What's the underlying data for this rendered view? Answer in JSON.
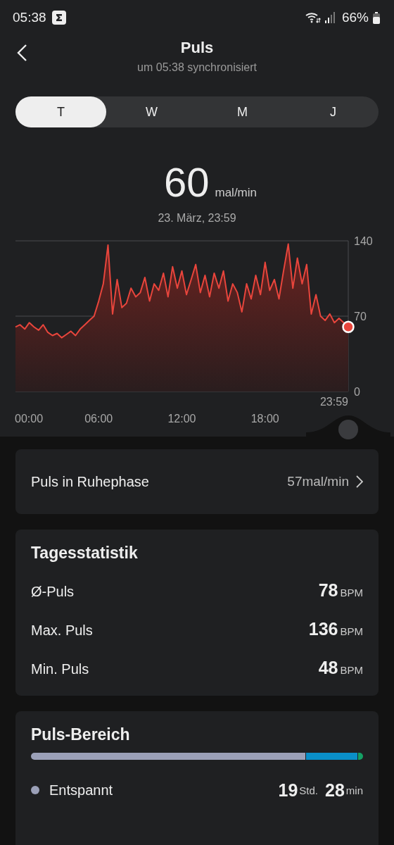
{
  "status_bar": {
    "time": "05:38",
    "battery": "66%"
  },
  "header": {
    "title": "Puls",
    "subtitle": "um 05:38 synchronisiert"
  },
  "tabs": [
    {
      "label": "T",
      "selected": true
    },
    {
      "label": "W",
      "selected": false
    },
    {
      "label": "M",
      "selected": false
    },
    {
      "label": "J",
      "selected": false
    }
  ],
  "reading": {
    "value": "60",
    "unit": "mal/min",
    "date": "23. März, 23:59"
  },
  "chart_data": {
    "type": "area",
    "xlim": [
      0,
      24
    ],
    "ylim": [
      0,
      140
    ],
    "yticks": [
      0,
      70,
      140
    ],
    "xticks": [
      {
        "value": 0,
        "label": "00:00"
      },
      {
        "value": 6,
        "label": "06:00"
      },
      {
        "value": 12,
        "label": "12:00"
      },
      {
        "value": 18,
        "label": "18:00"
      }
    ],
    "x": [
      0,
      0.33,
      0.67,
      1,
      1.33,
      1.67,
      2,
      2.33,
      2.67,
      3,
      3.33,
      3.67,
      4,
      4.33,
      4.67,
      5,
      5.33,
      5.67,
      6,
      6.33,
      6.67,
      7,
      7.33,
      7.67,
      8,
      8.33,
      8.67,
      9,
      9.33,
      9.67,
      10,
      10.33,
      10.67,
      11,
      11.33,
      11.67,
      12,
      12.33,
      12.67,
      13,
      13.33,
      13.67,
      14,
      14.33,
      14.67,
      15,
      15.33,
      15.67,
      16,
      16.33,
      16.67,
      17,
      17.33,
      17.67,
      18,
      18.33,
      18.67,
      19,
      19.33,
      19.67,
      20,
      20.33,
      20.67,
      21,
      21.33,
      21.67,
      22,
      22.33,
      22.67,
      23,
      23.33,
      24
    ],
    "series": [
      {
        "color": "#e8453c",
        "values": [
          60,
          62,
          58,
          64,
          60,
          57,
          62,
          55,
          52,
          54,
          50,
          53,
          56,
          52,
          58,
          62,
          66,
          70,
          84,
          100,
          136,
          72,
          104,
          78,
          82,
          96,
          88,
          92,
          106,
          84,
          100,
          94,
          110,
          88,
          116,
          96,
          112,
          90,
          104,
          118,
          92,
          108,
          88,
          110,
          96,
          112,
          84,
          100,
          92,
          74,
          100,
          86,
          108,
          90,
          120,
          94,
          104,
          86,
          112,
          137,
          96,
          124,
          100,
          118,
          72,
          90,
          70,
          66,
          72,
          64,
          68,
          60
        ]
      }
    ],
    "annotations": [
      "23:59"
    ]
  },
  "resting": {
    "label": "Puls in Ruhephase",
    "value": "57mal/min"
  },
  "daily_stats": {
    "title": "Tagesstatistik",
    "rows": [
      {
        "label": "Ø-Puls",
        "value": "78",
        "unit": "BPM"
      },
      {
        "label": "Max. Puls",
        "value": "136",
        "unit": "BPM"
      },
      {
        "label": "Min. Puls",
        "value": "48",
        "unit": "BPM"
      }
    ]
  },
  "pulse_range": {
    "title": "Puls-Bereich",
    "segments": [
      {
        "color": "#9ba0b8"
      },
      {
        "color": "#0a8fc8"
      },
      {
        "color": "#14a064"
      }
    ],
    "rows": [
      {
        "label": "Entspannt",
        "color": "#9ba0b8",
        "hours": "19",
        "hours_unit": "Std.",
        "minutes": "28",
        "minutes_unit": "min"
      }
    ]
  }
}
